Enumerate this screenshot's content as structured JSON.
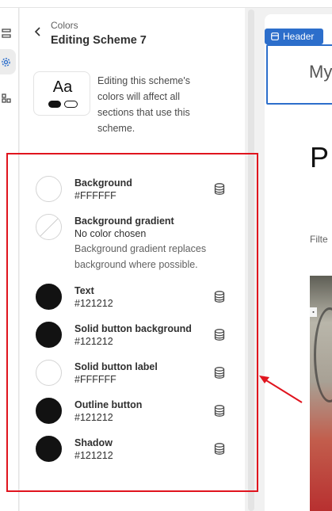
{
  "panel": {
    "breadcrumb": "Colors",
    "title": "Editing Scheme 7",
    "preview": {
      "sample_text": "Aa"
    },
    "note": "Editing this scheme's colors will affect all sections that use this scheme."
  },
  "colors": [
    {
      "label": "Background",
      "value": "#FFFFFF",
      "swatch": "light"
    },
    {
      "label": "Background gradient",
      "value": "No color chosen",
      "help": "Background gradient replaces background where possible.",
      "swatch": "none"
    },
    {
      "label": "Text",
      "value": "#121212",
      "swatch": "dark"
    },
    {
      "label": "Solid button background",
      "value": "#121212",
      "swatch": "dark"
    },
    {
      "label": "Solid button label",
      "value": "#FFFFFF",
      "swatch": "light"
    },
    {
      "label": "Outline button",
      "value": "#121212",
      "swatch": "dark"
    },
    {
      "label": "Shadow",
      "value": "#121212",
      "swatch": "dark"
    }
  ],
  "canvas": {
    "section_tag": "Header",
    "store_name": "My",
    "heading": "P",
    "filter_label": "Filte"
  },
  "theme": {
    "accent": "#2c6ecb",
    "annotation": "#e0141e"
  }
}
